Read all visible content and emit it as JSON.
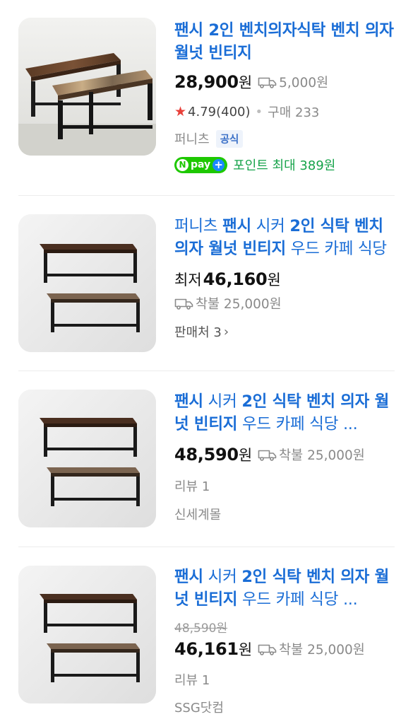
{
  "products": [
    {
      "title_parts": [
        {
          "text": "팬시 2인 벤치의자식탁 벤치 의자 월넛 빈티지",
          "bold": true
        }
      ],
      "price_prefix": "",
      "price": "28,900",
      "currency": "원",
      "shipping": "5,000원",
      "rating_star": "★",
      "rating": "4.79",
      "reviews": "(400)",
      "purchases": "구매 233",
      "seller": "퍼니츠",
      "official_badge": "공식",
      "npay_label": "pay",
      "npay_n": "N",
      "npay_plus": "+",
      "point_text": "포인트 최대 389원"
    },
    {
      "title_parts": [
        {
          "text": "퍼니츠 ",
          "bold": false
        },
        {
          "text": "팬시",
          "bold": true
        },
        {
          "text": " 시커 ",
          "bold": false
        },
        {
          "text": "2인 식탁 벤치 의자 월넛 빈티지",
          "bold": true
        },
        {
          "text": " 우드 카페 식당 ...",
          "bold": false
        }
      ],
      "price_prefix": "최저",
      "price": "46,160",
      "currency": "원",
      "shipping": "착불 25,000원",
      "sellers_label": "판매처 3"
    },
    {
      "title_parts": [
        {
          "text": "팬시",
          "bold": true
        },
        {
          "text": " 시커 ",
          "bold": false
        },
        {
          "text": "2인 식탁 벤치 의자 월넛 빈티지",
          "bold": true
        },
        {
          "text": " 우드 카페 식당 ...",
          "bold": false
        }
      ],
      "price": "48,590",
      "currency": "원",
      "shipping": "착불 25,000원",
      "review_label": "리뷰 1",
      "mall": "신세계몰"
    },
    {
      "title_parts": [
        {
          "text": "팬시",
          "bold": true
        },
        {
          "text": " 시커 ",
          "bold": false
        },
        {
          "text": "2인 식탁 벤치 의자 월넛 빈티지",
          "bold": true
        },
        {
          "text": " 우드 카페 식당 ...",
          "bold": false
        }
      ],
      "original_price": "48,590원",
      "price": "46,161",
      "currency": "원",
      "shipping": "착불 25,000원",
      "review_label": "리뷰 1",
      "mall": "SSG닷컴"
    }
  ],
  "colors": {
    "title_blue": "#1a6dd6",
    "star_red": "#e8403a",
    "npay_green": "#1ec800",
    "point_green": "#16a34a"
  },
  "icons": {
    "shipping": "truck-icon",
    "rating": "star-icon",
    "more": "chevron-right-icon"
  }
}
